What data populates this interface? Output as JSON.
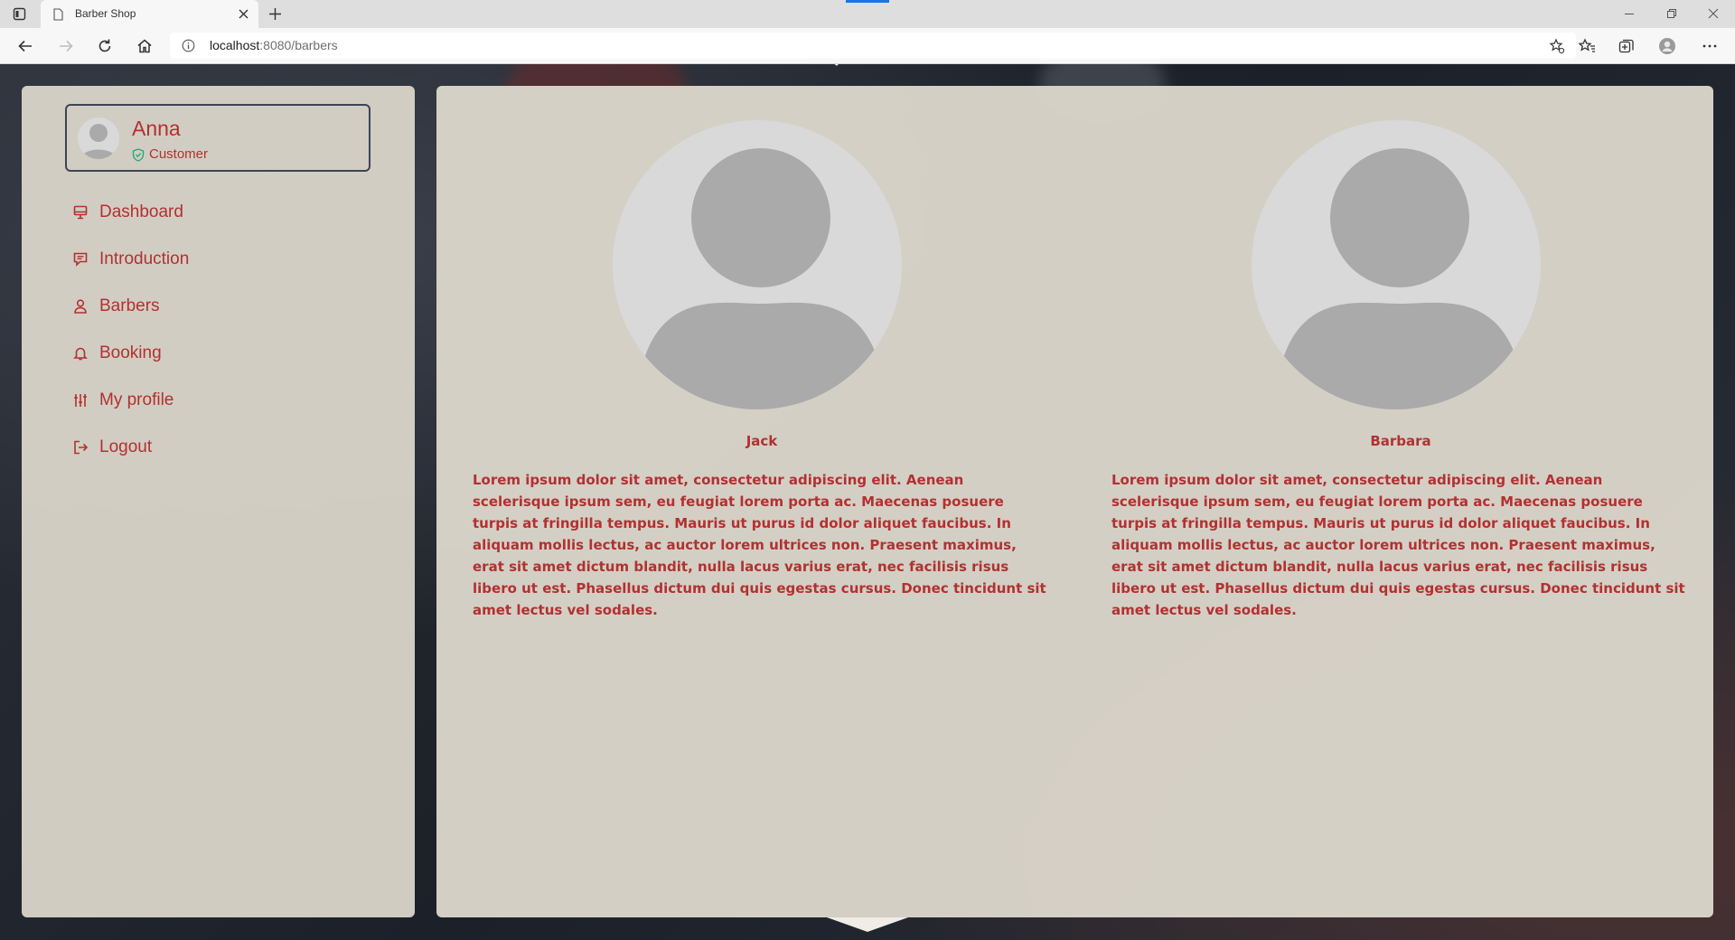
{
  "browser": {
    "tab_title": "Barber Shop",
    "url_host": "localhost",
    "url_path": ":8080/barbers"
  },
  "user": {
    "name": "Anna",
    "role": "Customer"
  },
  "menu": [
    {
      "label": "Dashboard",
      "icon": "monitor-icon"
    },
    {
      "label": "Introduction",
      "icon": "message-icon"
    },
    {
      "label": "Barbers",
      "icon": "person-icon"
    },
    {
      "label": "Booking",
      "icon": "bell-icon"
    },
    {
      "label": "My profile",
      "icon": "sliders-icon"
    },
    {
      "label": "Logout",
      "icon": "logout-icon"
    }
  ],
  "barbers": [
    {
      "name": "Jack",
      "description": "Lorem ipsum dolor sit amet, consectetur adipiscing elit. Aenean scelerisque ipsum sem, eu feugiat lorem porta ac. Maecenas posuere turpis at fringilla tempus. Mauris ut purus id dolor aliquet faucibus. In aliquam mollis lectus, ac auctor lorem ultrices non. Praesent maximus, erat sit amet dictum blandit, nulla lacus varius erat, nec facilisis risus libero ut est. Phasellus dictum dui quis egestas cursus. Donec tincidunt sit amet lectus vel sodales."
    },
    {
      "name": "Barbara",
      "description": "Lorem ipsum dolor sit amet, consectetur adipiscing elit. Aenean scelerisque ipsum sem, eu feugiat lorem porta ac. Maecenas posuere turpis at fringilla tempus. Mauris ut purus id dolor aliquet faucibus. In aliquam mollis lectus, ac auctor lorem ultrices non. Praesent maximus, erat sit amet dictum blandit, nulla lacus varius erat, nec facilisis risus libero ut est. Phasellus dictum dui quis egestas cursus. Donec tincidunt sit amet lectus vel sodales."
    }
  ],
  "colors": {
    "accent": "#b23131",
    "panel": "#d8d3c8",
    "background": "#1e2530",
    "avatar_bg": "#d9d9d9",
    "avatar_fg": "#aaaaaa"
  }
}
